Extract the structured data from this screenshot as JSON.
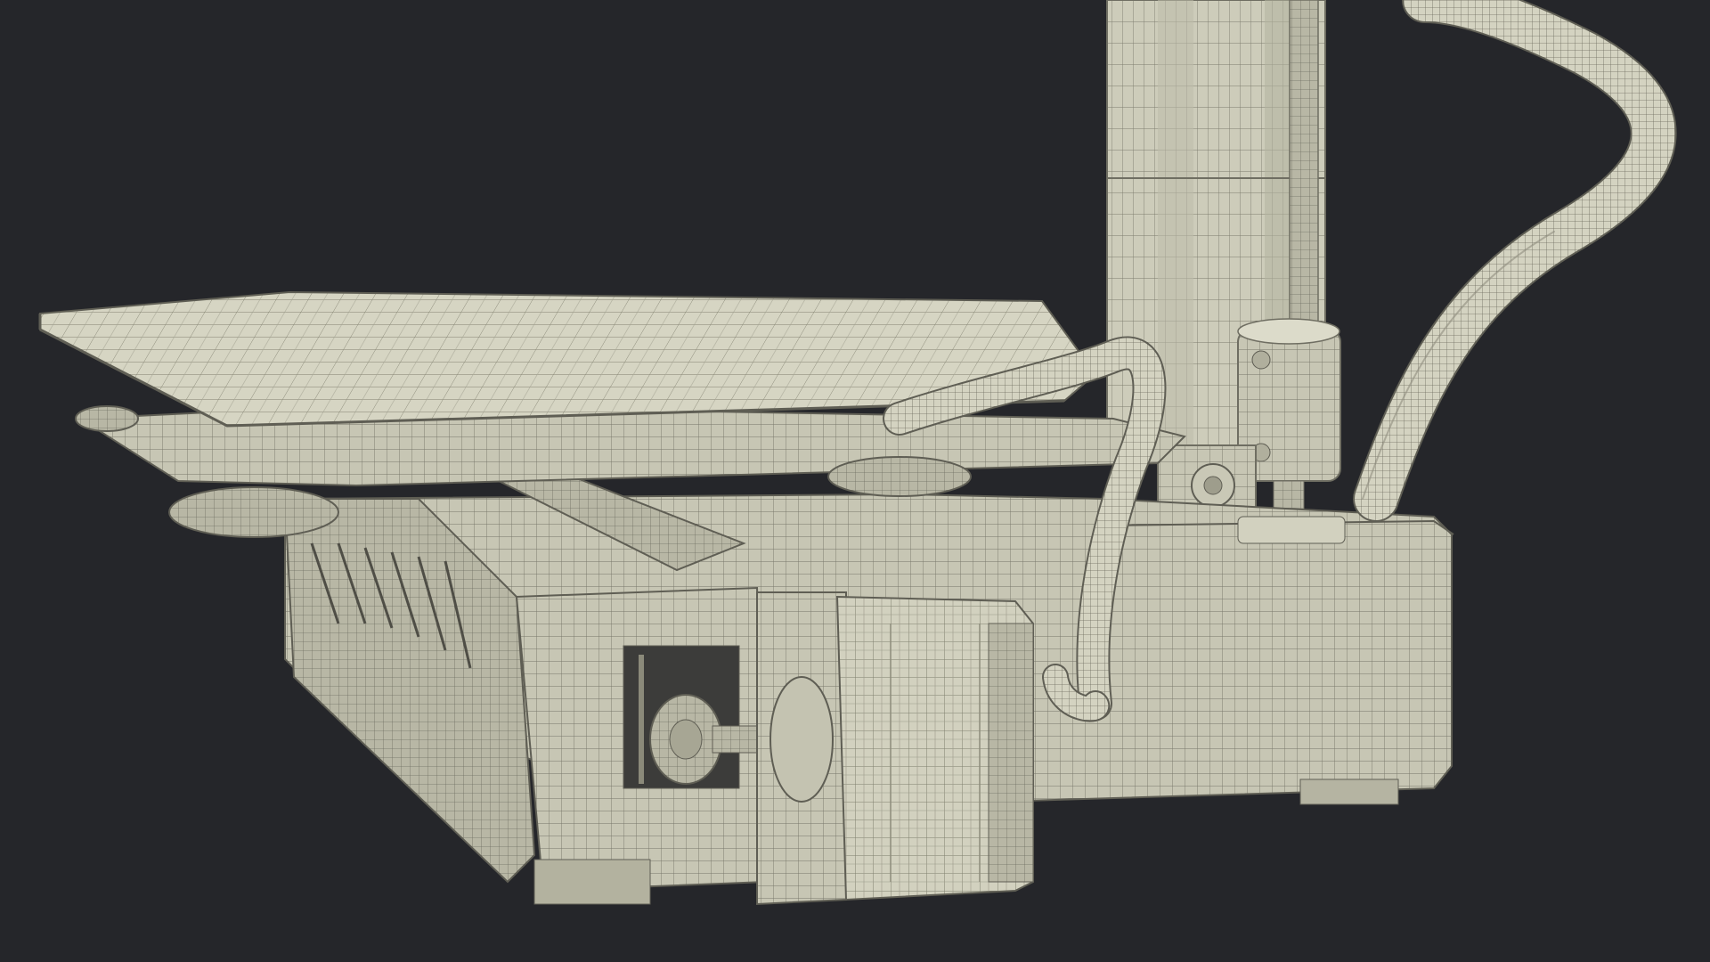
{
  "scene": {
    "subject": "3d-printer-wireframe-render",
    "colors": {
      "background": "#25262a",
      "surface": "#cfcfbd",
      "surface_light": "#deddcc",
      "surface_dark": "#a9a896",
      "wire": "#7a7a6a"
    }
  }
}
